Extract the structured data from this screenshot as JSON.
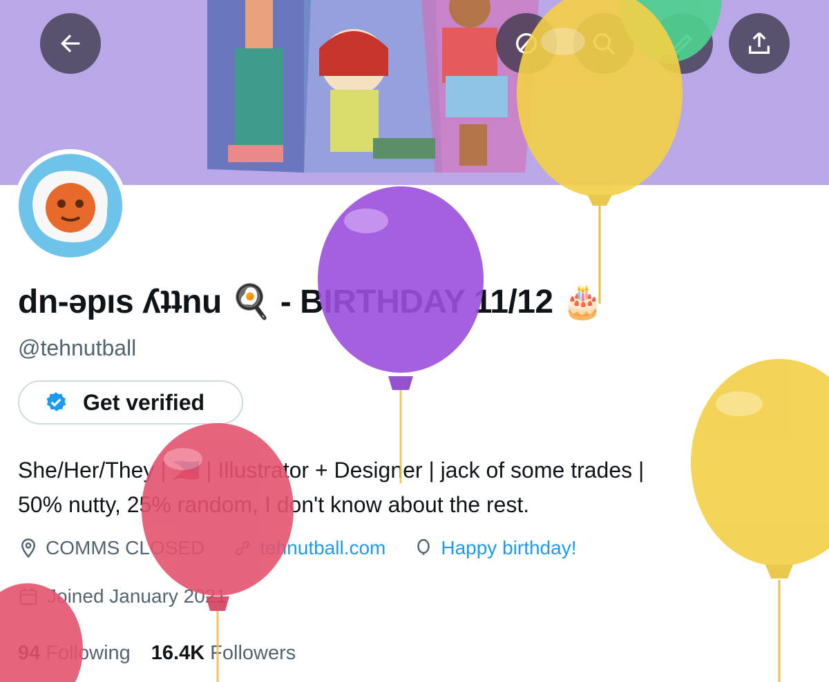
{
  "header": {
    "back_icon": "arrow-left-icon",
    "action_icons": [
      "grok-icon",
      "search-icon",
      "edit-icon",
      "share-icon"
    ]
  },
  "profile": {
    "display_name_main": "dn-əpıs ʎʇʇnu",
    "display_name_emoji": "🍳",
    "display_name_rest": " - BIRTHDAY 11/12 🎂",
    "handle": "@tehnutball",
    "verify_label": "Get verified",
    "bio_line1": "She/Her/They | 🇵🇭 | Illustrator + Designer | jack of some trades |",
    "bio_line2": "50% nutty, 25% random, I don't know about the rest.",
    "location": "COMMS CLOSED",
    "website": "tehnutball.com",
    "birthday": "Happy birthday!",
    "joined": "Joined January 2021",
    "following_count": "94",
    "following_label": "Following",
    "followers_count": "16.4K",
    "followers_label": "Followers"
  },
  "colors": {
    "banner": "#b9a7e8",
    "link": "#1d9bf0",
    "secondary_text": "#536471",
    "verified_badge": "#1d9bf0",
    "balloon_yellow": "#f3d046",
    "balloon_purple": "#9b4fdb",
    "balloon_red": "#e4536f",
    "balloon_green": "#4fd08f"
  }
}
